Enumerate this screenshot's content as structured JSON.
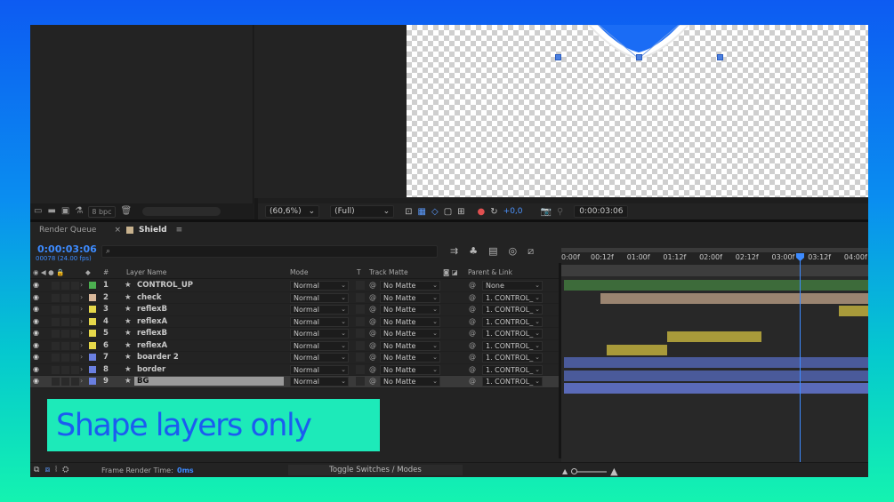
{
  "colors": {
    "accent": "#3d8bff",
    "panel": "#232323",
    "overlay_bg": "#1deab9",
    "overlay_text": "#1b5cf0"
  },
  "project_panel": {
    "bpc": "8 bpc",
    "icons": [
      "interpret-footage-icon",
      "folder-icon",
      "new-comp-icon",
      "flowchart-icon",
      "trash-icon"
    ]
  },
  "viewer_toolbar": {
    "zoom": "(60,6%)",
    "resolution": "(Full)",
    "exposure": "+0,0",
    "timecode": "0:00:03:06"
  },
  "timeline": {
    "tabs": [
      {
        "label": "Render Queue"
      },
      {
        "label": "Shield"
      }
    ],
    "current_time": "0:00:03:06",
    "frame_info": "00078 (24.00 fps)",
    "search_placeholder": "⌕",
    "headers": {
      "number": "#",
      "layer_name": "Layer Name",
      "mode": "Mode",
      "t": "T",
      "track_matte": "Track Matte",
      "parent": "Parent & Link"
    },
    "layers": [
      {
        "num": "1",
        "name": "CONTROL_UP",
        "color": "#4caf50",
        "mode": "Normal",
        "matte": "No Matte",
        "parent": "None"
      },
      {
        "num": "2",
        "name": "check",
        "color": "#d9b89a",
        "mode": "Normal",
        "matte": "No Matte",
        "parent": "1. CONTROL_"
      },
      {
        "num": "3",
        "name": "reflexB",
        "color": "#e6d84a",
        "mode": "Normal",
        "matte": "No Matte",
        "parent": "1. CONTROL_"
      },
      {
        "num": "4",
        "name": "reflexA",
        "color": "#e6d84a",
        "mode": "Normal",
        "matte": "No Matte",
        "parent": "1. CONTROL_"
      },
      {
        "num": "5",
        "name": "reflexB",
        "color": "#e6d84a",
        "mode": "Normal",
        "matte": "No Matte",
        "parent": "1. CONTROL_"
      },
      {
        "num": "6",
        "name": "reflexA",
        "color": "#e6d84a",
        "mode": "Normal",
        "matte": "No Matte",
        "parent": "1. CONTROL_"
      },
      {
        "num": "7",
        "name": "boarder 2",
        "color": "#6a7fe0",
        "mode": "Normal",
        "matte": "No Matte",
        "parent": "1. CONTROL_"
      },
      {
        "num": "8",
        "name": "border",
        "color": "#6a7fe0",
        "mode": "Normal",
        "matte": "No Matte",
        "parent": "1. CONTROL_"
      },
      {
        "num": "9",
        "name": "BG",
        "color": "#6a7fe0",
        "mode": "Normal",
        "matte": "No Matte",
        "parent": "1. CONTROL_"
      }
    ],
    "ruler_ticks": [
      "0:00f",
      "00:12f",
      "01:00f",
      "01:12f",
      "02:00f",
      "02:12f",
      "03:00f",
      "03:12f",
      "04:00f"
    ],
    "frame_render_time_label": "Frame Render Time:",
    "frame_render_time": "0ms",
    "toggle_label": "Toggle Switches / Modes"
  },
  "overlay": {
    "text": "Shape layers only"
  }
}
